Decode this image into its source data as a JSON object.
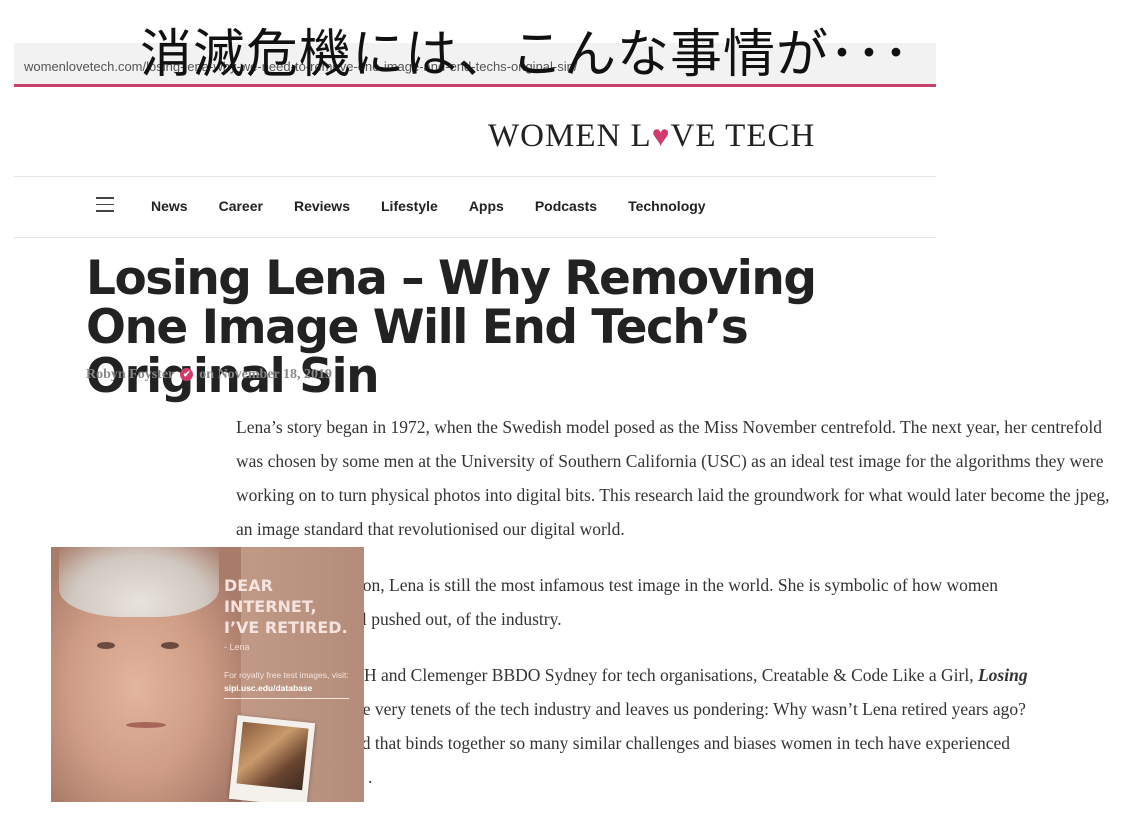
{
  "overlay": {
    "title": "消滅危機には、こんな事情が･･･"
  },
  "browser": {
    "url": "womenlovetech.com/losing-lena-why-we-need-to-remove-one-image-and-end-techs-original-sin/"
  },
  "site": {
    "logo_left": "WOMEN L",
    "logo_heart": "♥",
    "logo_right": "VE TECH"
  },
  "nav": {
    "items": [
      {
        "label": "News"
      },
      {
        "label": "Career"
      },
      {
        "label": "Reviews"
      },
      {
        "label": "Lifestyle"
      },
      {
        "label": "Apps"
      },
      {
        "label": "Podcasts"
      },
      {
        "label": "Technology"
      }
    ]
  },
  "article": {
    "title": "Losing Lena – Why Removing One Image Will End Tech’s Original Sin",
    "author": "Robyn Foyster",
    "date": "on November 18, 2019",
    "paragraphs": [
      "Lena’s story began in 1972, when the Swedish model posed as the Miss November centrefold. The next year, her centrefold was chosen by some men at the University of Southern California (USC) as an ideal test image for the algorithms they were working on to turn physical photos into digital bits. This research laid the groundwork for what would later become the jpeg, an image standard that revolutionised our digital world.",
      "ars on, Lena is still the most infamous test image in the world. She is symbolic of how women",
      "l pushed out, of the industry.",
      "H and Clemenger BBDO Sydney for tech organisations, Creatable & Code Like a Girl,",
      "Losing",
      "he very tenets of the tech industry and leaves us pondering: Why wasn’t Lena retired years ago?",
      "ad that binds together so many similar challenges and biases women in tech have experienced",
      "."
    ]
  },
  "ad": {
    "headline": "DEAR\nINTERNET,\nI’VE RETIRED.",
    "signature": "- Lena",
    "text": "For royalty free test images, visit:",
    "link": "sipi.usc.edu/database"
  }
}
